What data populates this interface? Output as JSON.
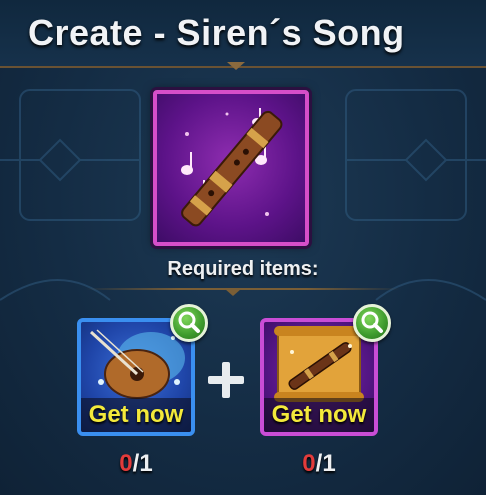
{
  "title": "Create - Siren´s Song",
  "result_item": {
    "icon": "siren-flute-icon",
    "rarity_color": "#d64ec9"
  },
  "required_label": "Required items:",
  "ingredients": [
    {
      "icon": "lute-icon",
      "action_label": "Get now",
      "have": "0",
      "separator": "/",
      "need": "1",
      "rarity_color": "#3a8ff0"
    },
    {
      "icon": "flute-scroll-icon",
      "action_label": "Get now",
      "have": "0",
      "separator": "/",
      "need": "1",
      "rarity_color": "#c94dd6"
    }
  ],
  "colors": {
    "have_zero": "#e23b3b",
    "get_now": "#f3e93b",
    "search_button": "#3d9a2c"
  }
}
